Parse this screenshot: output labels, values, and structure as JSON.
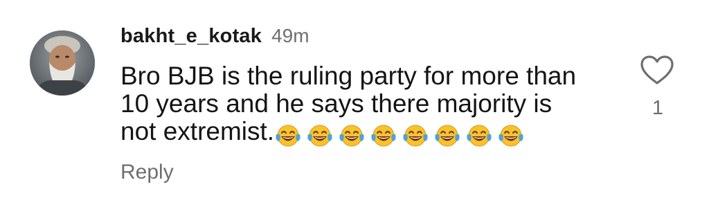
{
  "comment": {
    "username": "bakht_e_kotak",
    "time": "49m",
    "text": "Bro BJB is the ruling party for more than\n10 years and he says there majority is\nnot extremist.",
    "emoji_count": 8,
    "emoji_icon": "face-with-tears-of-joy-icon",
    "reply_label": "Reply",
    "like_icon": "heart-outline-icon",
    "like_count": "1"
  },
  "colors": {
    "text": "#141414",
    "muted": "#6e6e6e",
    "emoji_face": "#f8c22d",
    "emoji_tears": "#4aa3df"
  }
}
